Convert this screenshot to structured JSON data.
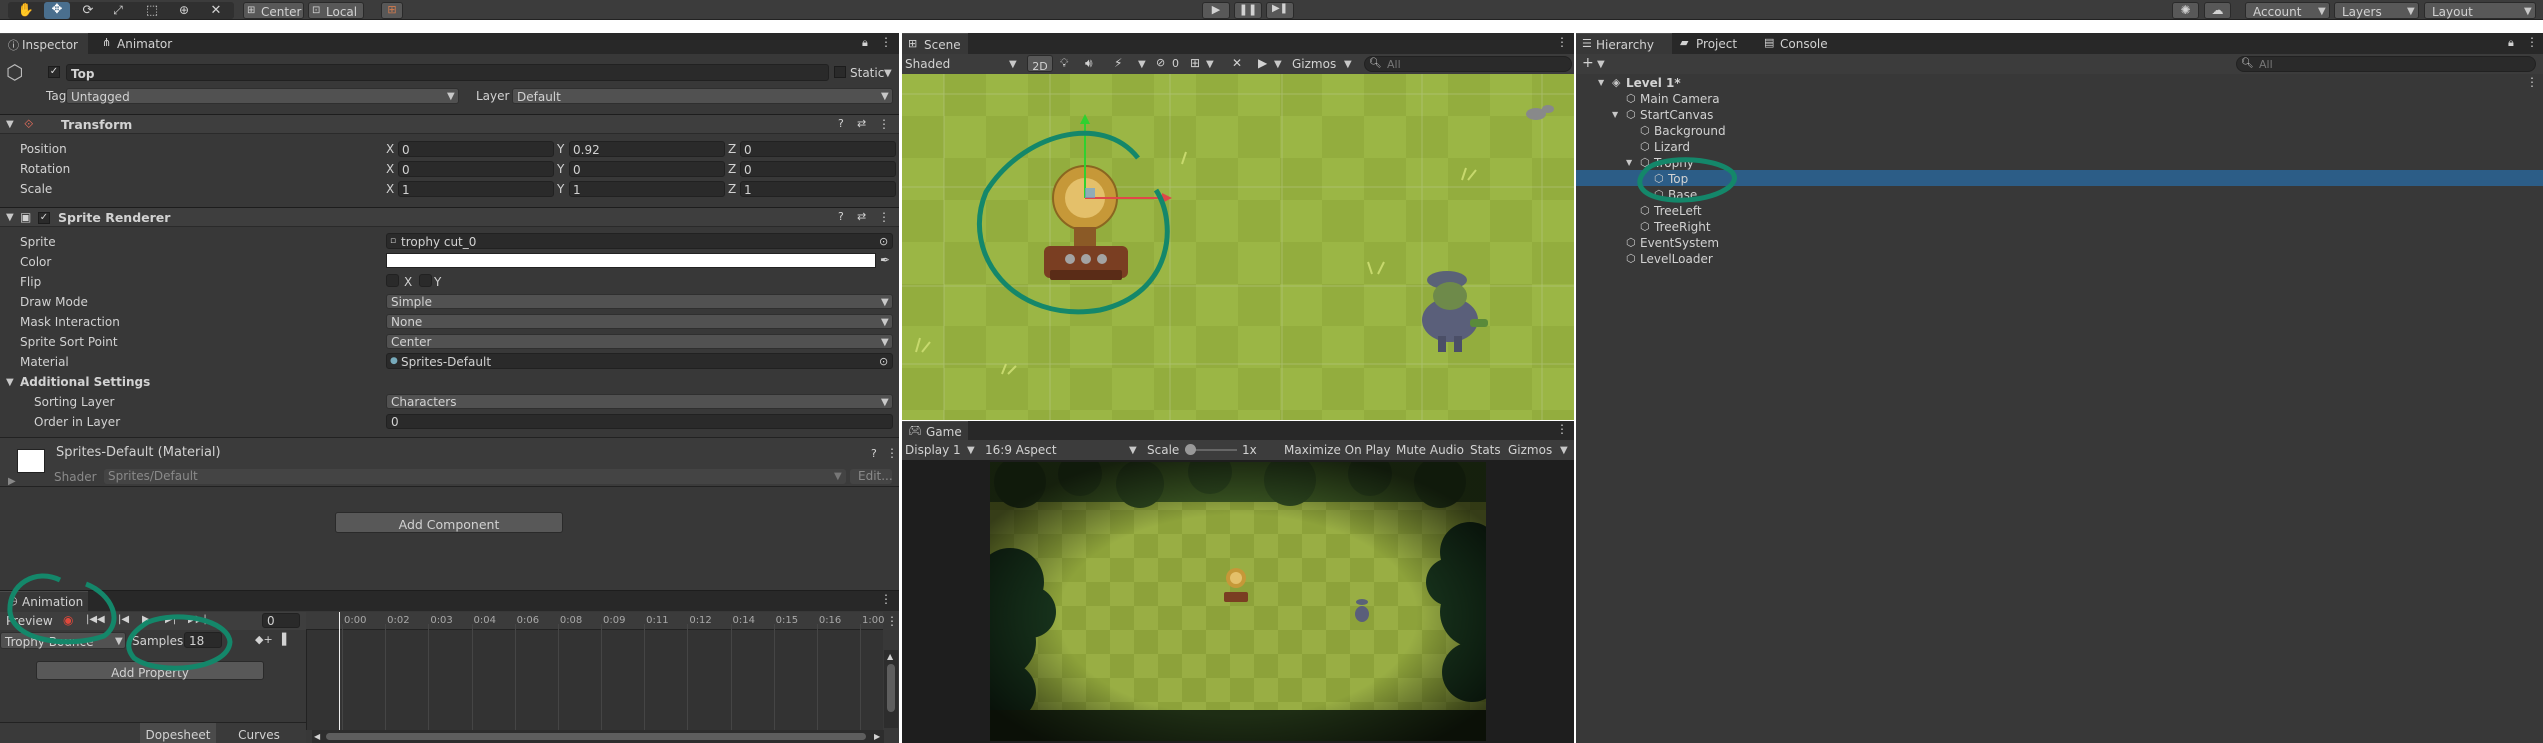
{
  "toolbar": {
    "pivot": "Center",
    "space": "Local",
    "account": "Account",
    "layers": "Layers",
    "layout": "Layout"
  },
  "inspector": {
    "tabs": [
      "Inspector",
      "Animator"
    ],
    "object_name": "Top",
    "static_label": "Static",
    "tag_label": "Tag",
    "tag_value": "Untagged",
    "layer_label": "Layer",
    "layer_value": "Default",
    "transform": {
      "title": "Transform",
      "rows": [
        {
          "label": "Position",
          "x": "0",
          "y": "0.92",
          "z": "0"
        },
        {
          "label": "Rotation",
          "x": "0",
          "y": "0",
          "z": "0"
        },
        {
          "label": "Scale",
          "x": "1",
          "y": "1",
          "z": "1"
        }
      ]
    },
    "sprite_renderer": {
      "title": "Sprite Renderer",
      "sprite_label": "Sprite",
      "sprite_value": "trophy cut_0",
      "color_label": "Color",
      "flip_label": "Flip",
      "flip_x": "X",
      "flip_y": "Y",
      "draw_mode_label": "Draw Mode",
      "draw_mode_value": "Simple",
      "mask_label": "Mask Interaction",
      "mask_value": "None",
      "sort_point_label": "Sprite Sort Point",
      "sort_point_value": "Center",
      "material_label": "Material",
      "material_value": "Sprites-Default",
      "additional_settings": "Additional Settings",
      "sorting_layer_label": "Sorting Layer",
      "sorting_layer_value": "Characters",
      "order_label": "Order in Layer",
      "order_value": "0"
    },
    "material": {
      "name": "Sprites-Default (Material)",
      "shader_label": "Shader",
      "shader_value": "Sprites/Default",
      "edit_label": "Edit..."
    },
    "add_component": "Add Component",
    "axes": {
      "x": "X",
      "y": "Y",
      "z": "Z"
    }
  },
  "animation": {
    "tab": "Animation",
    "preview": "Preview",
    "frame": "0",
    "clip": "Trophy Bounce",
    "samples_label": "Samples",
    "samples_value": "18",
    "add_property": "Add Property",
    "dopesheet": "Dopesheet",
    "curves": "Curves",
    "ticks": [
      "0:00",
      "0:02",
      "0:03",
      "0:04",
      "0:06",
      "0:08",
      "0:09",
      "0:11",
      "0:12",
      "0:14",
      "0:15",
      "0:16",
      "1:00"
    ]
  },
  "scene": {
    "tab": "Scene",
    "shading": "Shaded",
    "mode_2d": "2D",
    "hidden_count": "0",
    "gizmos": "Gizmos",
    "search_placeholder": "All"
  },
  "game": {
    "tab": "Game",
    "display": "Display 1",
    "aspect": "16:9 Aspect",
    "scale_label": "Scale",
    "scale_value": "1x",
    "maximize": "Maximize On Play",
    "mute": "Mute Audio",
    "stats": "Stats",
    "gizmos": "Gizmos"
  },
  "hierarchy": {
    "tabs": [
      "Hierarchy",
      "Project",
      "Console"
    ],
    "search_placeholder": "All",
    "items": [
      {
        "label": "Level 1*"
      },
      {
        "label": "Main Camera"
      },
      {
        "label": "StartCanvas"
      },
      {
        "label": "Background"
      },
      {
        "label": "Lizard"
      },
      {
        "label": "Trophy"
      },
      {
        "label": "Top"
      },
      {
        "label": "Base"
      },
      {
        "label": "TreeLeft"
      },
      {
        "label": "TreeRight"
      },
      {
        "label": "EventSystem"
      },
      {
        "label": "LevelLoader"
      }
    ]
  },
  "colors": {
    "accent": "#14876a",
    "selection": "#2c5d87",
    "panel": "#383838",
    "grass": "#8ca83a"
  }
}
